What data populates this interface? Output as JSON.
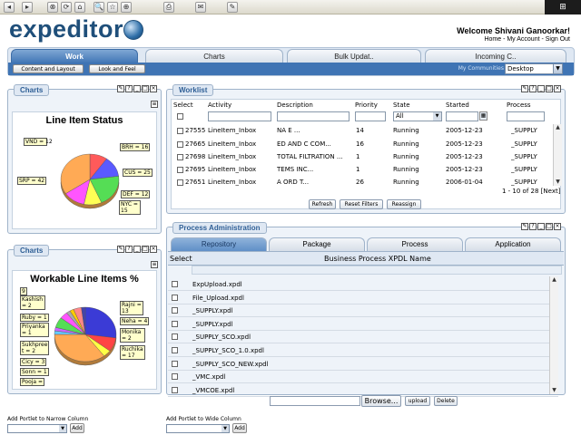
{
  "browser": {
    "buttons": [
      "◂",
      "▸",
      "⊗",
      "⟳",
      "⌂",
      "🔍",
      "☆",
      "⊕",
      "⎙",
      "✉",
      "✎"
    ]
  },
  "header": {
    "logo": "expeditor",
    "welcome": "Welcome Shivani Ganoorkar!",
    "links": "Home - My Account - Sign Out"
  },
  "tabs": [
    {
      "label": "Work",
      "active": true
    },
    {
      "label": "Charts",
      "active": false
    },
    {
      "label": "Bulk Updat..",
      "active": false
    },
    {
      "label": "Incoming C..",
      "active": false
    }
  ],
  "subtoolbar": {
    "content_layout": "Content and Layout",
    "look_feel": "Look and Feel",
    "community_label": "My Communities",
    "community_value": "Desktop"
  },
  "charts1": {
    "portlet_title": "Charts",
    "title": "Line Item Status",
    "labels": [
      "VND = 12",
      "BRH = 16",
      "CUS = 25",
      "DEF = 12",
      "NYC = 15",
      "SRP = 42"
    ]
  },
  "charts2": {
    "portlet_title": "Charts",
    "title": "Workable Line Items %",
    "labels": [
      "9",
      "Kashish = 2",
      "Ruby = 1",
      "Priyanka = 1",
      "Sukhpree t = 2",
      "Cicy = 3",
      "Sonn = 1",
      "Pooja =",
      "Rajni = 13",
      "Neha = 4",
      "Monika = 2",
      "Ruchika = 17"
    ]
  },
  "chart_data": [
    {
      "type": "pie",
      "title": "Line Item Status",
      "categories": [
        "VND",
        "BRH",
        "CUS",
        "DEF",
        "NYC",
        "SRP"
      ],
      "values": [
        12,
        16,
        25,
        12,
        15,
        42
      ],
      "colors": [
        "#ff5a5a",
        "#5a5aff",
        "#55dd55",
        "#ffff55",
        "#ff55ff",
        "#ffaa55"
      ]
    },
    {
      "type": "pie",
      "title": "Workable Line Items %",
      "categories": [
        "Rajni",
        "Neha",
        "Monika",
        "Ruchika",
        "Pooja",
        "Sonn",
        "Cicy",
        "Sukhpreet",
        "Priyanka",
        "Ruby",
        "Kashish",
        "9"
      ],
      "values": [
        13,
        4,
        2,
        17,
        1,
        1,
        3,
        2,
        1,
        1,
        2,
        1
      ],
      "colors": [
        "#3b3bd6",
        "#ff4444",
        "#ffff44",
        "#ffaa55",
        "#66ccff",
        "#cc66ff",
        "#55dd55",
        "#ff55ff",
        "#aaaaaa",
        "#ffcc00",
        "#ff8888",
        "#4444aa"
      ]
    }
  ],
  "worklist": {
    "portlet_title": "Worklist",
    "columns": [
      "Select",
      "Activity",
      "Description",
      "Priority",
      "State",
      "Started",
      "Process"
    ],
    "state_filter": "All",
    "rows": [
      {
        "id": "27555",
        "activity": "LineItem_Inbox",
        "description": "NA        E ...",
        "priority": "14",
        "state": "Running",
        "started": "2005-12-23",
        "process": "_SUPPLY"
      },
      {
        "id": "27665",
        "activity": "LineItem_Inbox",
        "description": "  ED AND C COM...",
        "priority": "16",
        "state": "Running",
        "started": "2005-12-23",
        "process": "_SUPPLY"
      },
      {
        "id": "27698",
        "activity": "LineItem_Inbox",
        "description": "TOTAL FILTRATION ...",
        "priority": "1",
        "state": "Running",
        "started": "2005-12-23",
        "process": "_SUPPLY"
      },
      {
        "id": "27695",
        "activity": "LineItem_Inbox",
        "description": "      TEMS INC...",
        "priority": "1",
        "state": "Running",
        "started": "2005-12-23",
        "process": "_SUPPLY"
      },
      {
        "id": "27651",
        "activity": "LineItem_Inbox",
        "description": "A             ORD T...",
        "priority": "26",
        "state": "Running",
        "started": "2006-01-04",
        "process": "_SUPPLY"
      }
    ],
    "pagination": "1 - 10 of 28 [Next]",
    "buttons": {
      "refresh": "Refresh",
      "reset": "Reset Filters",
      "reassign": "Reassign"
    }
  },
  "process_admin": {
    "portlet_title": "Process Administration",
    "tabs": [
      "Repository",
      "Package",
      "Process",
      "Application"
    ],
    "col_select": "Select",
    "col_name": "Business Process XPDL Name",
    "files": [
      "ExpUpload.xpdl",
      "File_Upload.xpdl",
      "_SUPPLY.xpdl",
      "_SUPPLY.xpdl",
      "_SUPPLY_SCO.xpdl",
      "_SUPPLY_SCO_1.0.xpdl",
      "_SUPPLY_SCO_NEW.xpdl",
      "_VMC.xpdl",
      "_VMCOE.xpdl"
    ],
    "browse": "Browse...",
    "upload": "upload",
    "delete": "Delete"
  },
  "footer": {
    "narrow_label": "Add Portlet to Narrow Column",
    "wide_label": "Add Portlet to Wide Column",
    "add": "Add"
  }
}
